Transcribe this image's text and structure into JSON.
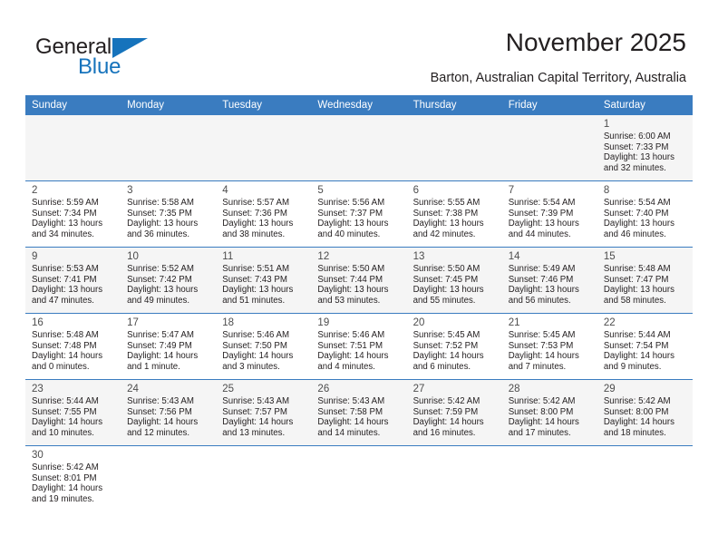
{
  "brand": {
    "name_top": "General",
    "name_bottom": "Blue"
  },
  "header": {
    "title": "November 2025",
    "location": "Barton, Australian Capital Territory, Australia"
  },
  "calendar": {
    "weekday_headers": [
      "Sunday",
      "Monday",
      "Tuesday",
      "Wednesday",
      "Thursday",
      "Friday",
      "Saturday"
    ],
    "accent_color": "#3a7cc0",
    "weeks": [
      [
        {
          "day": "",
          "sunrise": "",
          "sunset": "",
          "daylight1": "",
          "daylight2": ""
        },
        {
          "day": "",
          "sunrise": "",
          "sunset": "",
          "daylight1": "",
          "daylight2": ""
        },
        {
          "day": "",
          "sunrise": "",
          "sunset": "",
          "daylight1": "",
          "daylight2": ""
        },
        {
          "day": "",
          "sunrise": "",
          "sunset": "",
          "daylight1": "",
          "daylight2": ""
        },
        {
          "day": "",
          "sunrise": "",
          "sunset": "",
          "daylight1": "",
          "daylight2": ""
        },
        {
          "day": "",
          "sunrise": "",
          "sunset": "",
          "daylight1": "",
          "daylight2": ""
        },
        {
          "day": "1",
          "sunrise": "Sunrise: 6:00 AM",
          "sunset": "Sunset: 7:33 PM",
          "daylight1": "Daylight: 13 hours",
          "daylight2": "and 32 minutes."
        }
      ],
      [
        {
          "day": "2",
          "sunrise": "Sunrise: 5:59 AM",
          "sunset": "Sunset: 7:34 PM",
          "daylight1": "Daylight: 13 hours",
          "daylight2": "and 34 minutes."
        },
        {
          "day": "3",
          "sunrise": "Sunrise: 5:58 AM",
          "sunset": "Sunset: 7:35 PM",
          "daylight1": "Daylight: 13 hours",
          "daylight2": "and 36 minutes."
        },
        {
          "day": "4",
          "sunrise": "Sunrise: 5:57 AM",
          "sunset": "Sunset: 7:36 PM",
          "daylight1": "Daylight: 13 hours",
          "daylight2": "and 38 minutes."
        },
        {
          "day": "5",
          "sunrise": "Sunrise: 5:56 AM",
          "sunset": "Sunset: 7:37 PM",
          "daylight1": "Daylight: 13 hours",
          "daylight2": "and 40 minutes."
        },
        {
          "day": "6",
          "sunrise": "Sunrise: 5:55 AM",
          "sunset": "Sunset: 7:38 PM",
          "daylight1": "Daylight: 13 hours",
          "daylight2": "and 42 minutes."
        },
        {
          "day": "7",
          "sunrise": "Sunrise: 5:54 AM",
          "sunset": "Sunset: 7:39 PM",
          "daylight1": "Daylight: 13 hours",
          "daylight2": "and 44 minutes."
        },
        {
          "day": "8",
          "sunrise": "Sunrise: 5:54 AM",
          "sunset": "Sunset: 7:40 PM",
          "daylight1": "Daylight: 13 hours",
          "daylight2": "and 46 minutes."
        }
      ],
      [
        {
          "day": "9",
          "sunrise": "Sunrise: 5:53 AM",
          "sunset": "Sunset: 7:41 PM",
          "daylight1": "Daylight: 13 hours",
          "daylight2": "and 47 minutes."
        },
        {
          "day": "10",
          "sunrise": "Sunrise: 5:52 AM",
          "sunset": "Sunset: 7:42 PM",
          "daylight1": "Daylight: 13 hours",
          "daylight2": "and 49 minutes."
        },
        {
          "day": "11",
          "sunrise": "Sunrise: 5:51 AM",
          "sunset": "Sunset: 7:43 PM",
          "daylight1": "Daylight: 13 hours",
          "daylight2": "and 51 minutes."
        },
        {
          "day": "12",
          "sunrise": "Sunrise: 5:50 AM",
          "sunset": "Sunset: 7:44 PM",
          "daylight1": "Daylight: 13 hours",
          "daylight2": "and 53 minutes."
        },
        {
          "day": "13",
          "sunrise": "Sunrise: 5:50 AM",
          "sunset": "Sunset: 7:45 PM",
          "daylight1": "Daylight: 13 hours",
          "daylight2": "and 55 minutes."
        },
        {
          "day": "14",
          "sunrise": "Sunrise: 5:49 AM",
          "sunset": "Sunset: 7:46 PM",
          "daylight1": "Daylight: 13 hours",
          "daylight2": "and 56 minutes."
        },
        {
          "day": "15",
          "sunrise": "Sunrise: 5:48 AM",
          "sunset": "Sunset: 7:47 PM",
          "daylight1": "Daylight: 13 hours",
          "daylight2": "and 58 minutes."
        }
      ],
      [
        {
          "day": "16",
          "sunrise": "Sunrise: 5:48 AM",
          "sunset": "Sunset: 7:48 PM",
          "daylight1": "Daylight: 14 hours",
          "daylight2": "and 0 minutes."
        },
        {
          "day": "17",
          "sunrise": "Sunrise: 5:47 AM",
          "sunset": "Sunset: 7:49 PM",
          "daylight1": "Daylight: 14 hours",
          "daylight2": "and 1 minute."
        },
        {
          "day": "18",
          "sunrise": "Sunrise: 5:46 AM",
          "sunset": "Sunset: 7:50 PM",
          "daylight1": "Daylight: 14 hours",
          "daylight2": "and 3 minutes."
        },
        {
          "day": "19",
          "sunrise": "Sunrise: 5:46 AM",
          "sunset": "Sunset: 7:51 PM",
          "daylight1": "Daylight: 14 hours",
          "daylight2": "and 4 minutes."
        },
        {
          "day": "20",
          "sunrise": "Sunrise: 5:45 AM",
          "sunset": "Sunset: 7:52 PM",
          "daylight1": "Daylight: 14 hours",
          "daylight2": "and 6 minutes."
        },
        {
          "day": "21",
          "sunrise": "Sunrise: 5:45 AM",
          "sunset": "Sunset: 7:53 PM",
          "daylight1": "Daylight: 14 hours",
          "daylight2": "and 7 minutes."
        },
        {
          "day": "22",
          "sunrise": "Sunrise: 5:44 AM",
          "sunset": "Sunset: 7:54 PM",
          "daylight1": "Daylight: 14 hours",
          "daylight2": "and 9 minutes."
        }
      ],
      [
        {
          "day": "23",
          "sunrise": "Sunrise: 5:44 AM",
          "sunset": "Sunset: 7:55 PM",
          "daylight1": "Daylight: 14 hours",
          "daylight2": "and 10 minutes."
        },
        {
          "day": "24",
          "sunrise": "Sunrise: 5:43 AM",
          "sunset": "Sunset: 7:56 PM",
          "daylight1": "Daylight: 14 hours",
          "daylight2": "and 12 minutes."
        },
        {
          "day": "25",
          "sunrise": "Sunrise: 5:43 AM",
          "sunset": "Sunset: 7:57 PM",
          "daylight1": "Daylight: 14 hours",
          "daylight2": "and 13 minutes."
        },
        {
          "day": "26",
          "sunrise": "Sunrise: 5:43 AM",
          "sunset": "Sunset: 7:58 PM",
          "daylight1": "Daylight: 14 hours",
          "daylight2": "and 14 minutes."
        },
        {
          "day": "27",
          "sunrise": "Sunrise: 5:42 AM",
          "sunset": "Sunset: 7:59 PM",
          "daylight1": "Daylight: 14 hours",
          "daylight2": "and 16 minutes."
        },
        {
          "day": "28",
          "sunrise": "Sunrise: 5:42 AM",
          "sunset": "Sunset: 8:00 PM",
          "daylight1": "Daylight: 14 hours",
          "daylight2": "and 17 minutes."
        },
        {
          "day": "29",
          "sunrise": "Sunrise: 5:42 AM",
          "sunset": "Sunset: 8:00 PM",
          "daylight1": "Daylight: 14 hours",
          "daylight2": "and 18 minutes."
        }
      ],
      [
        {
          "day": "30",
          "sunrise": "Sunrise: 5:42 AM",
          "sunset": "Sunset: 8:01 PM",
          "daylight1": "Daylight: 14 hours",
          "daylight2": "and 19 minutes."
        },
        {
          "day": "",
          "sunrise": "",
          "sunset": "",
          "daylight1": "",
          "daylight2": ""
        },
        {
          "day": "",
          "sunrise": "",
          "sunset": "",
          "daylight1": "",
          "daylight2": ""
        },
        {
          "day": "",
          "sunrise": "",
          "sunset": "",
          "daylight1": "",
          "daylight2": ""
        },
        {
          "day": "",
          "sunrise": "",
          "sunset": "",
          "daylight1": "",
          "daylight2": ""
        },
        {
          "day": "",
          "sunrise": "",
          "sunset": "",
          "daylight1": "",
          "daylight2": ""
        },
        {
          "day": "",
          "sunrise": "",
          "sunset": "",
          "daylight1": "",
          "daylight2": ""
        }
      ]
    ]
  }
}
